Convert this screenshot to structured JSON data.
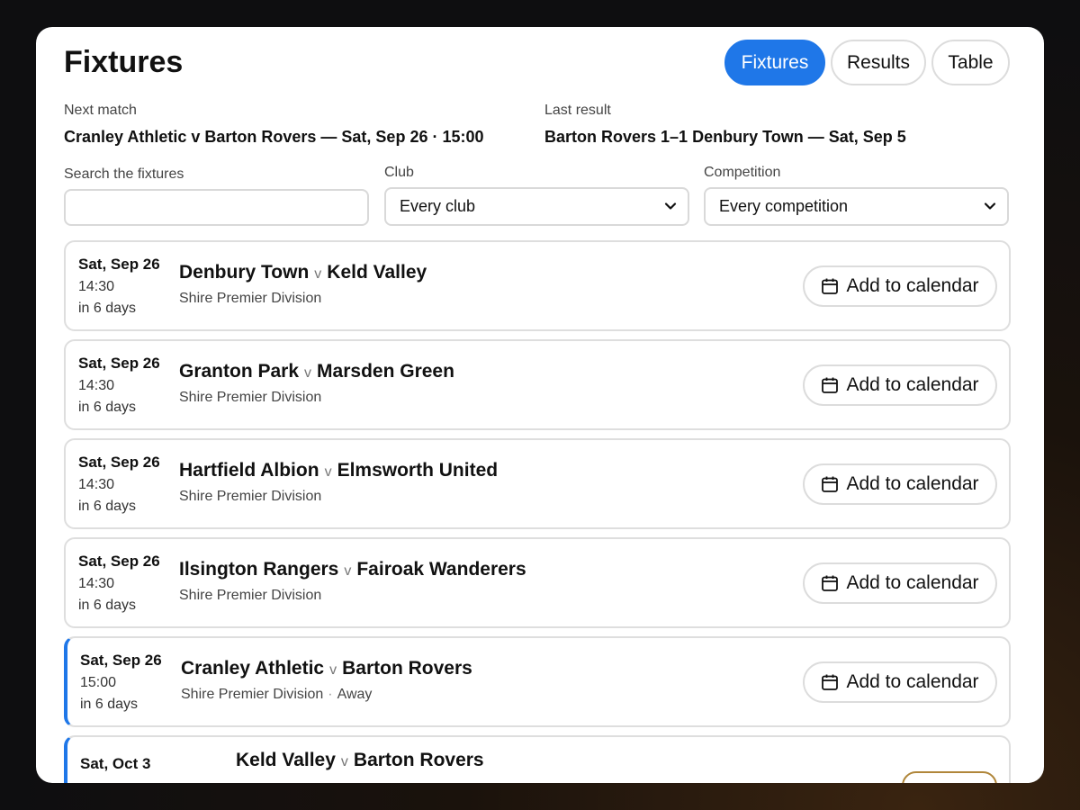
{
  "header": {
    "title": "Fixtures",
    "tabs": [
      {
        "label": "Fixtures",
        "active": true
      },
      {
        "label": "Results",
        "active": false
      },
      {
        "label": "Table",
        "active": false
      }
    ]
  },
  "summary": {
    "next_label": "Next match",
    "next_value": "Cranley Athletic v Barton Rovers — Sat, Sep 26 · 15:00",
    "last_label": "Last result",
    "last_value": "Barton Rovers 1–1 Denbury Town — Sat, Sep 5"
  },
  "filters": {
    "search_label": "Search the fixtures",
    "search_value": "",
    "club_label": "Club",
    "club_value": "Every club",
    "competition_label": "Competition",
    "competition_value": "Every competition"
  },
  "fixtures": [
    {
      "date": "Sat, Sep 26",
      "time": "14:30",
      "relative": "in 6 days",
      "home": "Denbury Town",
      "vs": "v",
      "away": "Keld Valley",
      "competition": "Shire Premier Division",
      "action": "Add to calendar"
    },
    {
      "date": "Sat, Sep 26",
      "time": "14:30",
      "relative": "in 6 days",
      "home": "Granton Park",
      "vs": "v",
      "away": "Marsden Green",
      "competition": "Shire Premier Division",
      "action": "Add to calendar"
    },
    {
      "date": "Sat, Sep 26",
      "time": "14:30",
      "relative": "in 6 days",
      "home": "Hartfield Albion",
      "vs": "v",
      "away": "Elmsworth United",
      "competition": "Shire Premier Division",
      "action": "Add to calendar"
    },
    {
      "date": "Sat, Sep 26",
      "time": "14:30",
      "relative": "in 6 days",
      "home": "Ilsington Rangers",
      "vs": "v",
      "away": "Fairoak Wanderers",
      "competition": "Shire Premier Division",
      "action": "Add to calendar"
    },
    {
      "date": "Sat, Sep 26",
      "time": "15:00",
      "relative": "in 6 days",
      "home": "Cranley Athletic",
      "vs": "v",
      "away": "Barton Rovers",
      "competition": "Shire Premier Division",
      "sep": "·",
      "venue": "Away",
      "action": "Add to calendar"
    },
    {
      "date": "Sat, Oct 3",
      "home": "Keld Valley",
      "vs": "v",
      "away": "Barton Rovers"
    }
  ],
  "colors": {
    "accent": "#1f77e8",
    "background": "#0e0e10",
    "postponed": "#b0863a"
  },
  "icons": {
    "calendar": "calendar-icon",
    "chevron": "chevron-down-icon"
  }
}
